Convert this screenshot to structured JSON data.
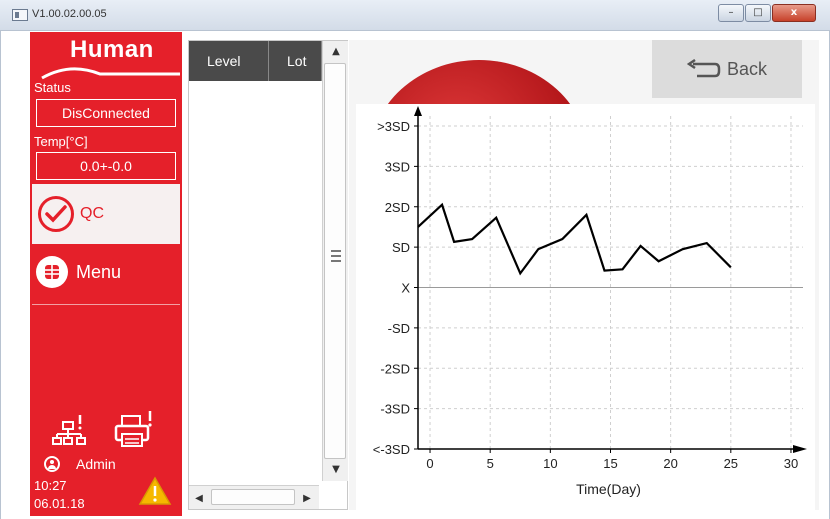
{
  "window": {
    "title": "V1.00.02.00.05",
    "minimize": "–",
    "maximize": "□",
    "close": "x"
  },
  "sidebar": {
    "logo": "Human",
    "status_label": "Status",
    "status_value": "DisConnected",
    "temp_label": "Temp[°C]",
    "temp_value": "0.0+-0.0",
    "qc_label": "QC",
    "menu_label": "Menu",
    "user": "Admin",
    "time": "10:27",
    "date": "06.01.18"
  },
  "table": {
    "columns": [
      "Level",
      "Lot"
    ]
  },
  "back_label": "Back",
  "colors": {
    "brand_red": "#e5202a",
    "line": "#000000",
    "grid": "#cfcfcf"
  },
  "chart_data": {
    "type": "line",
    "xlabel": "Time(Day)",
    "ylabel": "",
    "x_ticks": [
      0,
      5,
      10,
      15,
      20,
      25,
      30
    ],
    "xlim": [
      -1,
      31
    ],
    "y_levels": [
      ">3SD",
      "3SD",
      "2SD",
      "SD",
      "X",
      "-SD",
      "-2SD",
      "-3SD",
      "<-3SD"
    ],
    "y_level_values": [
      4,
      3,
      2,
      1,
      0,
      -1,
      -2,
      -3,
      -4
    ],
    "ylim": [
      -4,
      4
    ],
    "grid": true,
    "series": [
      {
        "x": [
          -1,
          1,
          2,
          3.5,
          5.5,
          7.5,
          9,
          11,
          13,
          14.5,
          16,
          17.5,
          19,
          21,
          23,
          25
        ],
        "y": [
          1.5,
          2.05,
          1.13,
          1.2,
          1.73,
          0.35,
          0.95,
          1.2,
          1.8,
          0.42,
          0.45,
          1.03,
          0.65,
          0.95,
          1.1,
          0.5
        ]
      }
    ]
  }
}
